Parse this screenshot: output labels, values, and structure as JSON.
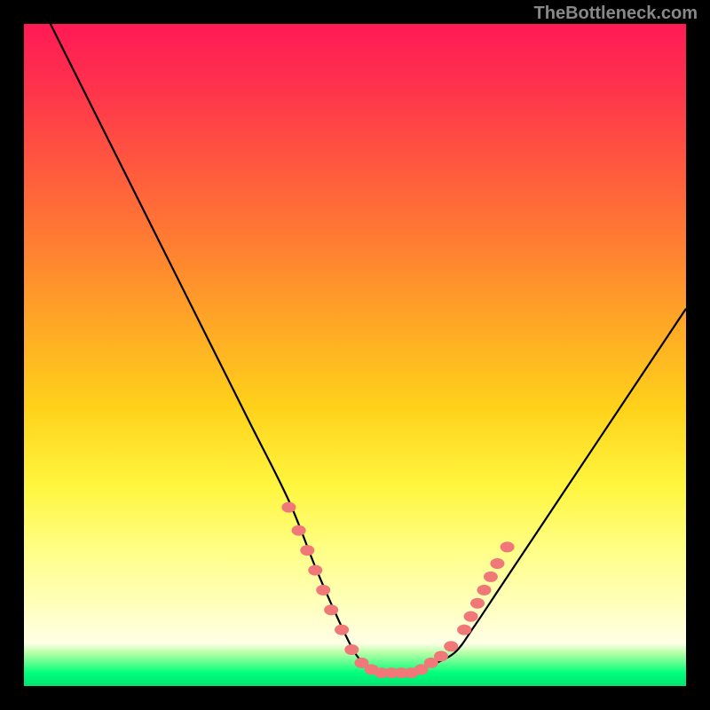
{
  "attribution": "TheBottleneck.com",
  "chart_data": {
    "type": "line",
    "title": "",
    "xlabel": "",
    "ylabel": "",
    "xlim": [
      0,
      100
    ],
    "ylim": [
      0,
      100
    ],
    "curve": {
      "name": "bottleneck-curve",
      "x": [
        4,
        10,
        16,
        22,
        28,
        34,
        40,
        44,
        47.5,
        50,
        52,
        55,
        58,
        61,
        65,
        68,
        72,
        78,
        86,
        94,
        100
      ],
      "y": [
        100,
        88,
        76,
        64,
        52,
        40,
        28,
        18,
        10,
        5,
        3,
        2,
        2,
        3,
        5,
        9,
        15,
        24,
        36,
        48,
        57
      ]
    },
    "highlight_points": {
      "name": "highlight-dots",
      "color": "#f07878",
      "points": [
        {
          "x": 40.0,
          "y": 27.0
        },
        {
          "x": 41.5,
          "y": 23.5
        },
        {
          "x": 42.8,
          "y": 20.5
        },
        {
          "x": 44.0,
          "y": 17.5
        },
        {
          "x": 45.2,
          "y": 14.5
        },
        {
          "x": 46.4,
          "y": 11.5
        },
        {
          "x": 48.0,
          "y": 8.5
        },
        {
          "x": 49.5,
          "y": 5.5
        },
        {
          "x": 51.0,
          "y": 3.5
        },
        {
          "x": 52.5,
          "y": 2.5
        },
        {
          "x": 54.0,
          "y": 2.0
        },
        {
          "x": 55.5,
          "y": 2.0
        },
        {
          "x": 57.0,
          "y": 2.0
        },
        {
          "x": 58.5,
          "y": 2.0
        },
        {
          "x": 60.0,
          "y": 2.5
        },
        {
          "x": 61.5,
          "y": 3.5
        },
        {
          "x": 63.0,
          "y": 4.5
        },
        {
          "x": 64.5,
          "y": 6.0
        },
        {
          "x": 66.5,
          "y": 8.5
        },
        {
          "x": 67.5,
          "y": 10.5
        },
        {
          "x": 68.5,
          "y": 12.5
        },
        {
          "x": 69.5,
          "y": 14.5
        },
        {
          "x": 70.5,
          "y": 16.5
        },
        {
          "x": 71.5,
          "y": 18.5
        },
        {
          "x": 73.0,
          "y": 21.0
        }
      ]
    },
    "gradient_stops": [
      {
        "pos": 0.0,
        "color": "#ff1a55"
      },
      {
        "pos": 0.3,
        "color": "#ff8a2e"
      },
      {
        "pos": 0.6,
        "color": "#ffe020"
      },
      {
        "pos": 0.88,
        "color": "#ffffbe"
      },
      {
        "pos": 0.95,
        "color": "#b6ffa8"
      },
      {
        "pos": 1.0,
        "color": "#00e56e"
      }
    ]
  }
}
